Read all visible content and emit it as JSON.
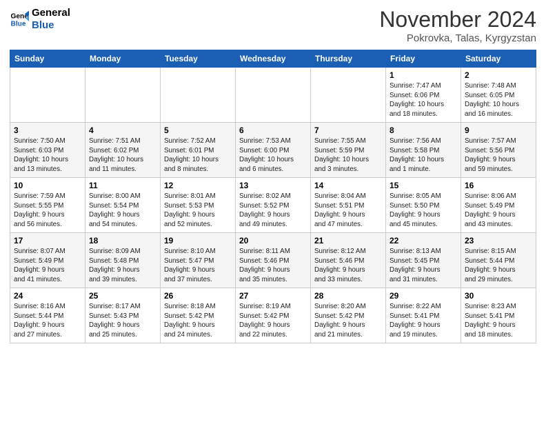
{
  "logo": {
    "line1": "General",
    "line2": "Blue"
  },
  "header": {
    "month": "November 2024",
    "location": "Pokrovka, Talas, Kyrgyzstan"
  },
  "weekdays": [
    "Sunday",
    "Monday",
    "Tuesday",
    "Wednesday",
    "Thursday",
    "Friday",
    "Saturday"
  ],
  "weeks": [
    [
      {
        "day": "",
        "info": ""
      },
      {
        "day": "",
        "info": ""
      },
      {
        "day": "",
        "info": ""
      },
      {
        "day": "",
        "info": ""
      },
      {
        "day": "",
        "info": ""
      },
      {
        "day": "1",
        "info": "Sunrise: 7:47 AM\nSunset: 6:06 PM\nDaylight: 10 hours\nand 18 minutes."
      },
      {
        "day": "2",
        "info": "Sunrise: 7:48 AM\nSunset: 6:05 PM\nDaylight: 10 hours\nand 16 minutes."
      }
    ],
    [
      {
        "day": "3",
        "info": "Sunrise: 7:50 AM\nSunset: 6:03 PM\nDaylight: 10 hours\nand 13 minutes."
      },
      {
        "day": "4",
        "info": "Sunrise: 7:51 AM\nSunset: 6:02 PM\nDaylight: 10 hours\nand 11 minutes."
      },
      {
        "day": "5",
        "info": "Sunrise: 7:52 AM\nSunset: 6:01 PM\nDaylight: 10 hours\nand 8 minutes."
      },
      {
        "day": "6",
        "info": "Sunrise: 7:53 AM\nSunset: 6:00 PM\nDaylight: 10 hours\nand 6 minutes."
      },
      {
        "day": "7",
        "info": "Sunrise: 7:55 AM\nSunset: 5:59 PM\nDaylight: 10 hours\nand 3 minutes."
      },
      {
        "day": "8",
        "info": "Sunrise: 7:56 AM\nSunset: 5:58 PM\nDaylight: 10 hours\nand 1 minute."
      },
      {
        "day": "9",
        "info": "Sunrise: 7:57 AM\nSunset: 5:56 PM\nDaylight: 9 hours\nand 59 minutes."
      }
    ],
    [
      {
        "day": "10",
        "info": "Sunrise: 7:59 AM\nSunset: 5:55 PM\nDaylight: 9 hours\nand 56 minutes."
      },
      {
        "day": "11",
        "info": "Sunrise: 8:00 AM\nSunset: 5:54 PM\nDaylight: 9 hours\nand 54 minutes."
      },
      {
        "day": "12",
        "info": "Sunrise: 8:01 AM\nSunset: 5:53 PM\nDaylight: 9 hours\nand 52 minutes."
      },
      {
        "day": "13",
        "info": "Sunrise: 8:02 AM\nSunset: 5:52 PM\nDaylight: 9 hours\nand 49 minutes."
      },
      {
        "day": "14",
        "info": "Sunrise: 8:04 AM\nSunset: 5:51 PM\nDaylight: 9 hours\nand 47 minutes."
      },
      {
        "day": "15",
        "info": "Sunrise: 8:05 AM\nSunset: 5:50 PM\nDaylight: 9 hours\nand 45 minutes."
      },
      {
        "day": "16",
        "info": "Sunrise: 8:06 AM\nSunset: 5:49 PM\nDaylight: 9 hours\nand 43 minutes."
      }
    ],
    [
      {
        "day": "17",
        "info": "Sunrise: 8:07 AM\nSunset: 5:49 PM\nDaylight: 9 hours\nand 41 minutes."
      },
      {
        "day": "18",
        "info": "Sunrise: 8:09 AM\nSunset: 5:48 PM\nDaylight: 9 hours\nand 39 minutes."
      },
      {
        "day": "19",
        "info": "Sunrise: 8:10 AM\nSunset: 5:47 PM\nDaylight: 9 hours\nand 37 minutes."
      },
      {
        "day": "20",
        "info": "Sunrise: 8:11 AM\nSunset: 5:46 PM\nDaylight: 9 hours\nand 35 minutes."
      },
      {
        "day": "21",
        "info": "Sunrise: 8:12 AM\nSunset: 5:46 PM\nDaylight: 9 hours\nand 33 minutes."
      },
      {
        "day": "22",
        "info": "Sunrise: 8:13 AM\nSunset: 5:45 PM\nDaylight: 9 hours\nand 31 minutes."
      },
      {
        "day": "23",
        "info": "Sunrise: 8:15 AM\nSunset: 5:44 PM\nDaylight: 9 hours\nand 29 minutes."
      }
    ],
    [
      {
        "day": "24",
        "info": "Sunrise: 8:16 AM\nSunset: 5:44 PM\nDaylight: 9 hours\nand 27 minutes."
      },
      {
        "day": "25",
        "info": "Sunrise: 8:17 AM\nSunset: 5:43 PM\nDaylight: 9 hours\nand 25 minutes."
      },
      {
        "day": "26",
        "info": "Sunrise: 8:18 AM\nSunset: 5:42 PM\nDaylight: 9 hours\nand 24 minutes."
      },
      {
        "day": "27",
        "info": "Sunrise: 8:19 AM\nSunset: 5:42 PM\nDaylight: 9 hours\nand 22 minutes."
      },
      {
        "day": "28",
        "info": "Sunrise: 8:20 AM\nSunset: 5:42 PM\nDaylight: 9 hours\nand 21 minutes."
      },
      {
        "day": "29",
        "info": "Sunrise: 8:22 AM\nSunset: 5:41 PM\nDaylight: 9 hours\nand 19 minutes."
      },
      {
        "day": "30",
        "info": "Sunrise: 8:23 AM\nSunset: 5:41 PM\nDaylight: 9 hours\nand 18 minutes."
      }
    ]
  ]
}
